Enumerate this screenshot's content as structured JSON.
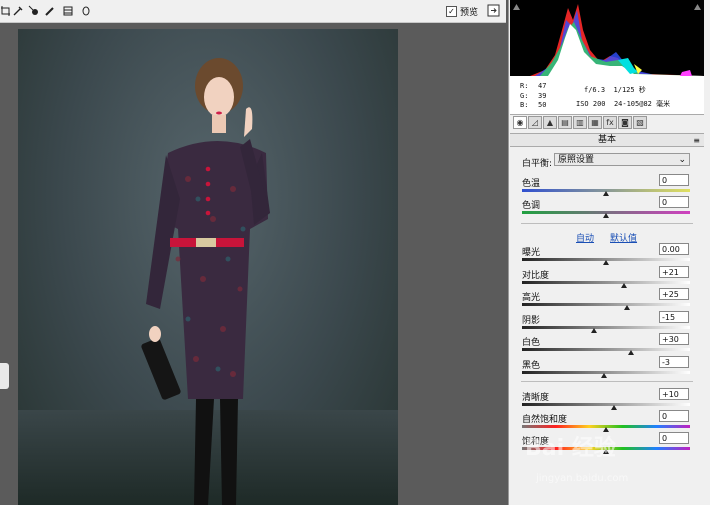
{
  "toolbar": {
    "tools": [
      "crop-icon",
      "eyedropper-icon",
      "target-adjust-icon",
      "brush-icon",
      "stack-icon",
      "circle-icon"
    ],
    "preview_label": "预览",
    "preview_checked": true
  },
  "info": {
    "r_label": "R:",
    "r_value": "47",
    "g_label": "G:",
    "g_value": "39",
    "b_label": "B:",
    "b_value": "50",
    "aperture": "f/6.3",
    "shutter": "1/125 秒",
    "iso": "ISO 200",
    "lens": "24-105@82 毫米"
  },
  "panel": {
    "section_title": "基本",
    "white_balance_label": "白平衡:",
    "white_balance_value": "原照设置",
    "auto_link": "自动",
    "default_link": "默认值",
    "sliders_wb": [
      {
        "label": "色温",
        "value": "0",
        "pos": 0.5
      },
      {
        "label": "色调",
        "value": "0",
        "pos": 0.5
      }
    ],
    "sliders_tone": [
      {
        "label": "曝光",
        "value": "0.00",
        "pos": 0.5
      },
      {
        "label": "对比度",
        "value": "+21",
        "pos": 0.61
      },
      {
        "label": "高光",
        "value": "+25",
        "pos": 0.625
      },
      {
        "label": "阴影",
        "value": "-15",
        "pos": 0.43
      },
      {
        "label": "白色",
        "value": "+30",
        "pos": 0.65
      },
      {
        "label": "黑色",
        "value": "-3",
        "pos": 0.49
      }
    ],
    "sliders_presence": [
      {
        "label": "清晰度",
        "value": "+10",
        "pos": 0.55
      },
      {
        "label": "自然饱和度",
        "value": "0",
        "pos": 0.5
      },
      {
        "label": "饱和度",
        "value": "0",
        "pos": 0.5
      }
    ]
  },
  "watermark": {
    "text": "Bai 经验",
    "url": "jingyan.baidu.com"
  },
  "colors": {
    "panel_bg": "#f0f0f0",
    "link": "#1a4fb5",
    "dress": "#3a2a40",
    "belt": "#c8143a"
  }
}
